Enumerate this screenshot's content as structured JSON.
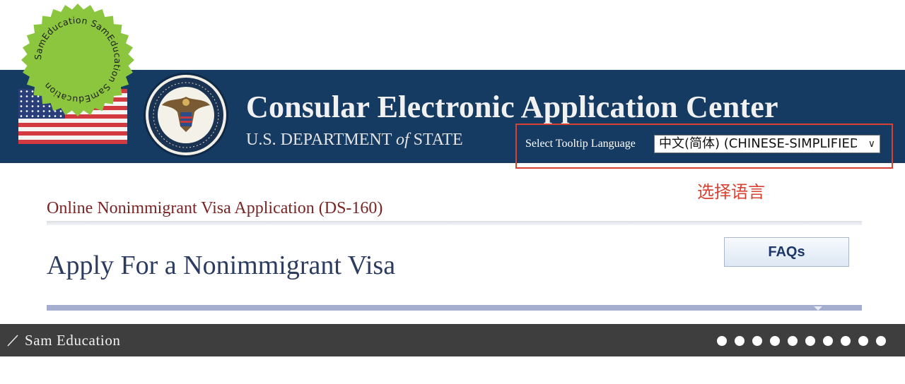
{
  "header": {
    "app_title": "Consular Electronic Application Center",
    "dept_prefix": "U.S. DEPARTMENT",
    "dept_of": "of",
    "dept_suffix": "STATE",
    "tooltip_language_label": "Select Tooltip Language",
    "tooltip_language_value": "中文(简体)  (CHINESE-SIMPLIFIED)",
    "annotation": "选择语言",
    "annotation_color": "#d8402f"
  },
  "main": {
    "form_title": "Online Nonimmigrant Visa Application (DS-160)",
    "page_title": "Apply For a Nonimmigrant Visa",
    "faqs_label": "FAQs"
  },
  "footer": {
    "brand": "Sam Education",
    "dot_count": 10
  },
  "watermark": {
    "text": "SamEducation SamEducation SamEducation",
    "color": "#8cc63f"
  },
  "colors": {
    "banner": "#163b63",
    "footer": "#3e3e3e",
    "title_red": "#7a2424",
    "heading_blue": "#2c3c61"
  }
}
